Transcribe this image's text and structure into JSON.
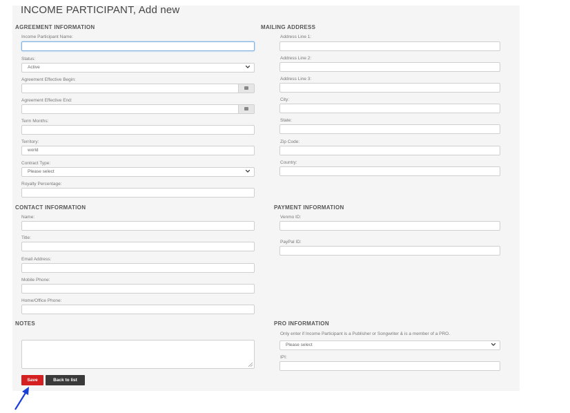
{
  "page": {
    "title": "INCOME PARTICIPANT, Add new"
  },
  "agreement": {
    "section": "AGREEMENT INFORMATION",
    "name_label": "Income Participant Name:",
    "status_label": "Status:",
    "status_value": "Active",
    "begin_label": "Agreement Effective Begin:",
    "end_label": "Agreement Effective End:",
    "term_label": "Term Months:",
    "territory_label": "Territory:",
    "territory_value": "world",
    "contract_label": "Contract Type:",
    "contract_value": "Please select",
    "royalty_label": "Royalty Percentage:"
  },
  "mailing": {
    "section": "MAILING ADDRESS",
    "address1_label": "Address Line 1:",
    "address2_label": "Address Line 2:",
    "address3_label": "Address Line 3:",
    "city_label": "City:",
    "state_label": "State:",
    "zip_label": "Zip Code:",
    "country_label": "Country:"
  },
  "contact": {
    "section": "CONTACT INFORMATION",
    "name_label": "Name:",
    "title_label": "Title:",
    "email_label": "Email Address:",
    "mobile_label": "Mobile Phone:",
    "home_label": "Home/Office Phone:"
  },
  "payment": {
    "section": "PAYMENT INFORMATION",
    "venmo_label": "Venmo ID:",
    "paypal_label": "PayPal ID:"
  },
  "notes": {
    "section": "NOTES"
  },
  "pro": {
    "section": "PRO INFORMATION",
    "hint": "Only enter if Income Participant is a Publisher or Songwriter & is a member of a PRO.",
    "select_value": "Please select",
    "ipi_label": "IPI:"
  },
  "actions": {
    "save_label": "Save",
    "back_label": "Back to list"
  },
  "colors": {
    "save": "#d42020",
    "back": "#3a3a3a",
    "arrow": "#1a3fd6",
    "focus": "#7fb0e0"
  },
  "icons": [
    "chevron-down-icon",
    "calendar-icon",
    "resize-grip-icon",
    "arrow-pointer-icon"
  ]
}
